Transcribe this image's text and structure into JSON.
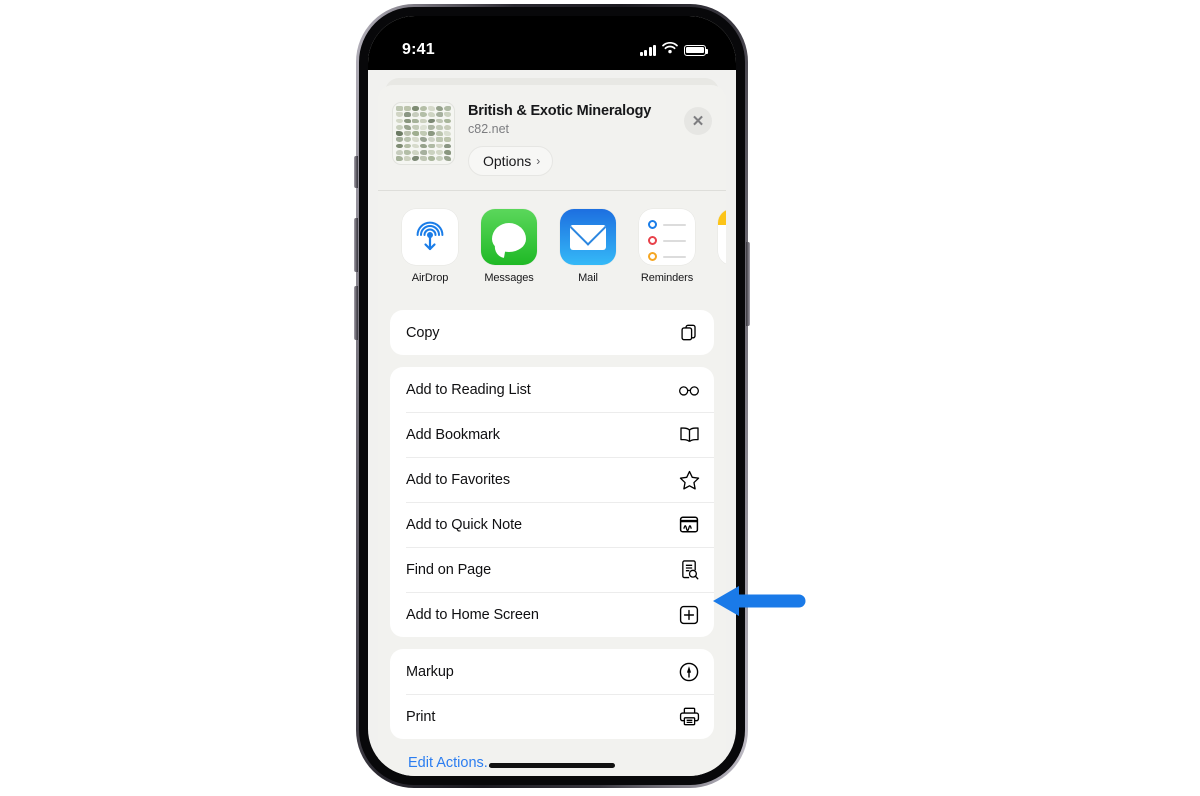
{
  "device": {
    "status_bar": {
      "time": "9:41",
      "cellular_icon": "cellular-bars-icon",
      "wifi_icon": "wifi-icon",
      "battery_icon": "battery-full-icon",
      "indicator_icon": "privacy-indicator-dot"
    },
    "home_indicator": "home-indicator"
  },
  "share_sheet": {
    "header": {
      "title": "British & Exotic Mineralogy",
      "url": "c82.net",
      "thumbnail_icon": "website-preview-thumbnail",
      "options_label": "Options",
      "options_chevron": "chevron-right-icon",
      "close_icon": "close-icon"
    },
    "apps": [
      {
        "label": "AirDrop",
        "icon": "airdrop-icon"
      },
      {
        "label": "Messages",
        "icon": "messages-icon"
      },
      {
        "label": "Mail",
        "icon": "mail-icon"
      },
      {
        "label": "Reminders",
        "icon": "reminders-icon"
      },
      {
        "label": "",
        "icon": "notes-icon"
      }
    ],
    "groups": [
      {
        "rows": [
          {
            "label": "Copy",
            "icon": "copy-icon"
          }
        ]
      },
      {
        "rows": [
          {
            "label": "Add to Reading List",
            "icon": "glasses-icon"
          },
          {
            "label": "Add Bookmark",
            "icon": "book-icon"
          },
          {
            "label": "Add to Favorites",
            "icon": "star-icon"
          },
          {
            "label": "Add to Quick Note",
            "icon": "quick-note-icon"
          },
          {
            "label": "Find on Page",
            "icon": "find-page-icon"
          },
          {
            "label": "Add to Home Screen",
            "icon": "plus-square-icon"
          }
        ]
      },
      {
        "rows": [
          {
            "label": "Markup",
            "icon": "markup-icon"
          },
          {
            "label": "Print",
            "icon": "printer-icon"
          }
        ]
      }
    ],
    "edit_actions_label": "Edit Actions..."
  },
  "annotation": {
    "arrow_icon": "left-pointing-arrow",
    "arrow_color": "#1a7ae8",
    "points_at": "Add to Home Screen"
  },
  "colors": {
    "accent_blue": "#2b7df0",
    "sheet_background": "#f2f2ef",
    "row_background": "#ffffff",
    "annotation_blue": "#1a7ae8"
  }
}
